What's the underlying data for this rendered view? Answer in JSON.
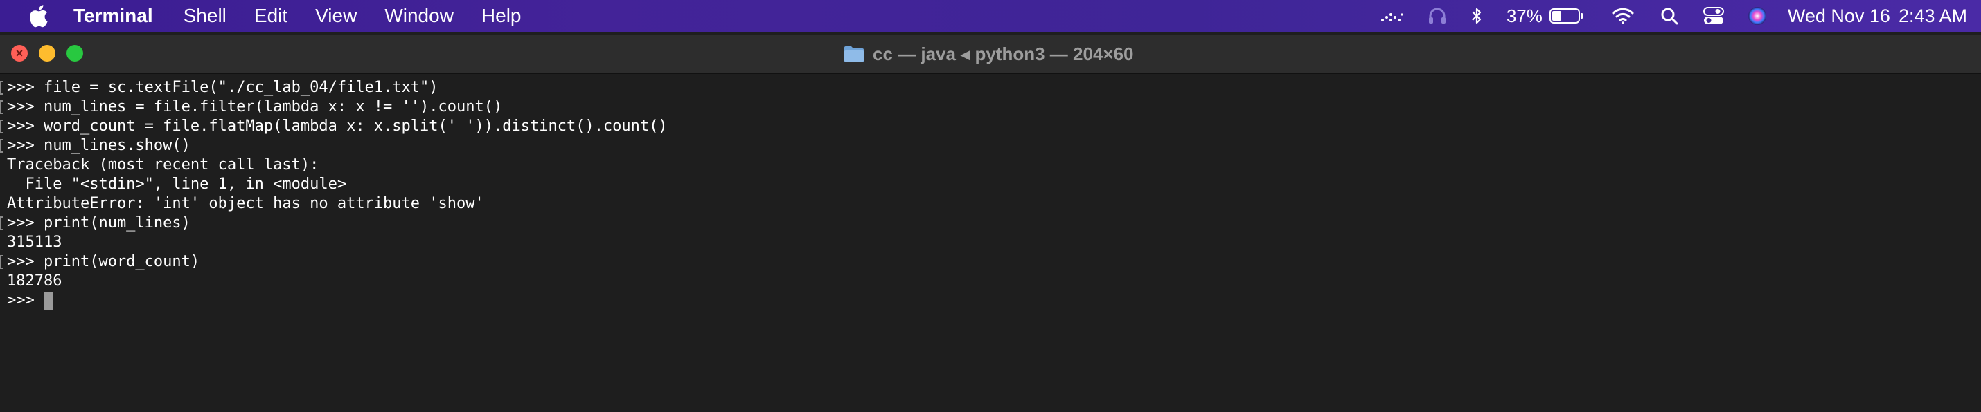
{
  "menubar": {
    "app_name": "Terminal",
    "items": [
      "Shell",
      "Edit",
      "View",
      "Window",
      "Help"
    ],
    "battery_percent": "37%",
    "date": "Wed Nov 16",
    "time": "2:43 AM"
  },
  "window": {
    "title": "cc — java ◂ python3 — 204×60"
  },
  "terminal": {
    "lines": [
      {
        "text": ">>> file = sc.textFile(\"./cc_lab_04/file1.txt\")",
        "marked": true
      },
      {
        "text": ">>> num_lines = file.filter(lambda x: x != '').count()",
        "marked": true
      },
      {
        "text": ">>> word_count = file.flatMap(lambda x: x.split(' ')).distinct().count()",
        "marked": true
      },
      {
        "text": ">>> num_lines.show()",
        "marked": true
      },
      {
        "text": "Traceback (most recent call last):",
        "marked": false
      },
      {
        "text": "  File \"<stdin>\", line 1, in <module>",
        "marked": false
      },
      {
        "text": "AttributeError: 'int' object has no attribute 'show'",
        "marked": false
      },
      {
        "text": ">>> print(num_lines)",
        "marked": true
      },
      {
        "text": "315113",
        "marked": false
      },
      {
        "text": ">>> print(word_count)",
        "marked": true
      },
      {
        "text": "182786",
        "marked": false
      }
    ],
    "prompt": ">>> "
  },
  "colors": {
    "menubar_bg": "#3f2597",
    "terminal_bg": "#1e1e1e",
    "titlebar_bg": "#2d2d2d",
    "text": "#ffffff",
    "close": "#ff5f57",
    "minimize": "#febc2e",
    "maximize": "#28c840"
  },
  "icons": {
    "menubar_right": [
      "dots-icon",
      "headphones-icon",
      "bluetooth-icon",
      "battery-icon",
      "wifi-icon",
      "search-icon",
      "control-center-icon",
      "siri-icon"
    ],
    "title": "folder-icon"
  }
}
